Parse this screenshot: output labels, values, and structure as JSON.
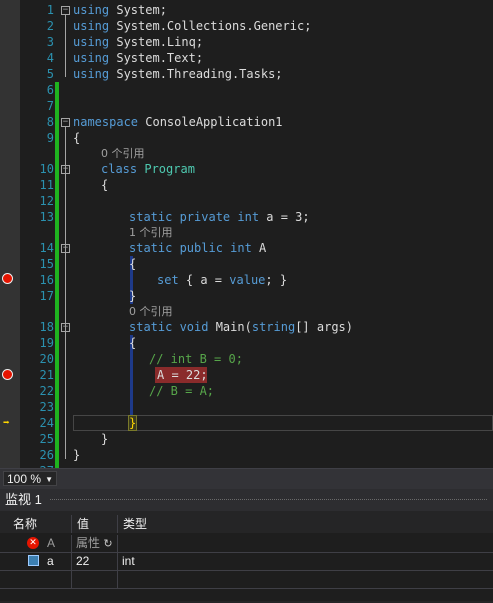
{
  "editor": {
    "line_numbers": [
      "1",
      "2",
      "3",
      "4",
      "5",
      "6",
      "7",
      "8",
      "9",
      "10",
      "11",
      "12",
      "13",
      "14",
      "15",
      "16",
      "17",
      "18",
      "19",
      "20",
      "21",
      "22",
      "23",
      "24",
      "25",
      "26",
      "27"
    ],
    "lines": {
      "l1_kw": "using",
      "l1_rest": " System;",
      "l2_kw": "using",
      "l2_rest": " System.Collections.Generic;",
      "l3_kw": "using",
      "l3_rest": " System.Linq;",
      "l4_kw": "using",
      "l4_rest": " System.Text;",
      "l5_kw": "using",
      "l5_rest": " System.Threading.Tasks;",
      "l8_kw": "namespace",
      "l8_rest": " ConsoleApplication1",
      "l9": "{",
      "ref_program": "0 个引用",
      "l10_kw": "class",
      "l10_ty": " Program",
      "l11": "{",
      "l13_kw": "static private int",
      "l13_rest": " a = 3;",
      "ref_a": "1 个引用",
      "l14_kw": "static public int",
      "l14_rest": " A",
      "l15": "{",
      "l16_kw": "set",
      "l16_a": " { a = ",
      "l16_kw2": "value",
      "l16_b": "; }",
      "l17": "}",
      "ref_main": "0 个引用",
      "l18_kw": "static void",
      "l18_rest": " Main(",
      "l18_kw2": "string",
      "l18_rest2": "[] args)",
      "l19": "{",
      "l20": "// int B = 0;",
      "l21": "A = 22;",
      "l22": "// B = A;",
      "l24": "}",
      "l25": "}",
      "l26": "}"
    }
  },
  "statusbar": {
    "zoom": "100 %"
  },
  "watch": {
    "title": "监视 1",
    "columns": [
      "名称",
      "值",
      "类型"
    ],
    "rows": [
      {
        "name": "A",
        "value": "属性",
        "type": ""
      },
      {
        "name": "a",
        "value": "22",
        "type": "int"
      }
    ]
  },
  "colors": {
    "keyword": "#569cd6",
    "type": "#4ec9b0",
    "comment": "#57a64a",
    "linenumber": "#2b91af",
    "breakpoint": "#e51400"
  }
}
